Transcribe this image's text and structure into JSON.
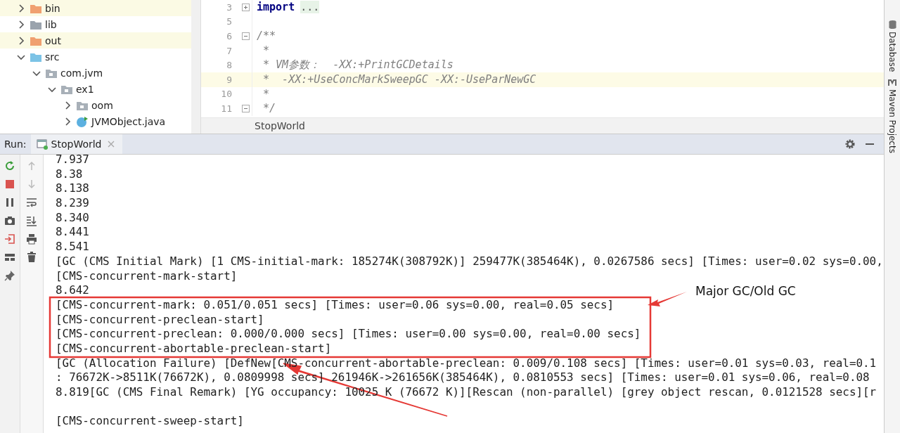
{
  "project_tree": [
    {
      "label": "bin",
      "kind": "excluded",
      "expanded": false
    },
    {
      "label": "lib",
      "kind": "folder",
      "expanded": false
    },
    {
      "label": "out",
      "kind": "excluded",
      "expanded": false
    },
    {
      "label": "src",
      "kind": "source",
      "expanded": true,
      "children": [
        {
          "label": "com.jvm",
          "kind": "package",
          "expanded": true,
          "children": [
            {
              "label": "ex1",
              "kind": "package",
              "expanded": true,
              "children": [
                {
                  "label": "oom",
                  "kind": "package",
                  "expanded": false
                },
                {
                  "label": "JVMObject.java",
                  "kind": "class",
                  "expanded": false
                }
              ]
            }
          ]
        }
      ]
    }
  ],
  "editor": {
    "lines": [
      {
        "number": "3",
        "kind": "import",
        "keyword": "import",
        "folded_text": "...",
        "foldable": true,
        "collapsed": true,
        "current": false
      },
      {
        "number": "5",
        "kind": "comment",
        "current": false
      },
      {
        "number": "6",
        "kind": "comment",
        "text": "/**",
        "foldable": true,
        "collapsed": false,
        "current": false
      },
      {
        "number": "7",
        "kind": "comment",
        "text": " *",
        "current": false
      },
      {
        "number": "8",
        "kind": "comment",
        "text": " * VM参数：  -XX:+PrintGCDetails",
        "current": false
      },
      {
        "number": "9",
        "kind": "comment",
        "text": " *  -XX:+UseConcMarkSweepGC -XX:-UseParNewGC",
        "current": true
      },
      {
        "number": "10",
        "kind": "comment",
        "text": " *",
        "current": false
      },
      {
        "number": "11",
        "kind": "comment",
        "text": " */",
        "foldable": true,
        "collapsed": false,
        "current": false
      }
    ],
    "breadcrumb": "StopWorld"
  },
  "side_tabs": [
    {
      "label": "Database",
      "kind": "database"
    },
    {
      "label": "Maven Projects",
      "kind": "maven"
    }
  ],
  "run_panel": {
    "label": "Run:",
    "tabs": [
      {
        "label": "StopWorld",
        "selected": true
      }
    ],
    "toolbar": [
      {
        "kind": "rerun"
      },
      {
        "kind": "stop"
      },
      {
        "kind": "pause"
      },
      {
        "kind": "camera"
      },
      {
        "kind": "exit"
      },
      {
        "kind": "layout"
      },
      {
        "kind": "pin"
      }
    ],
    "toolbar_2": [
      {
        "kind": "up",
        "disabled": true
      },
      {
        "kind": "down",
        "disabled": true
      },
      {
        "kind": "wrap"
      },
      {
        "kind": "scroll-end"
      },
      {
        "kind": "print"
      },
      {
        "kind": "trash"
      }
    ],
    "output": [
      {
        "text": "7.937"
      },
      {
        "text": "8.38"
      },
      {
        "text": "8.138"
      },
      {
        "text": "8.239"
      },
      {
        "text": "8.340"
      },
      {
        "text": "8.441"
      },
      {
        "text": "8.541"
      },
      {
        "text": "[GC (CMS Initial Mark) [1 CMS-initial-mark: 185274K(308792K)] 259477K(385464K), 0.0267586 secs] [Times: user=0.02 sys=0.00,"
      },
      {
        "text": "[CMS-concurrent-mark-start]"
      },
      {
        "text": "8.642"
      },
      {
        "text": "[CMS-concurrent-mark: 0.051/0.051 secs] [Times: user=0.06 sys=0.00, real=0.05 secs]"
      },
      {
        "text": "[CMS-concurrent-preclean-start]"
      },
      {
        "text": "[CMS-concurrent-preclean: 0.000/0.000 secs] [Times: user=0.00 sys=0.00, real=0.00 secs]"
      },
      {
        "text": "[CMS-concurrent-abortable-preclean-start]"
      },
      {
        "text": "[GC (Allocation Failure) [DefNew[CMS-concurrent-abortable-preclean: 0.009/0.108 secs] [Times: user=0.01 sys=0.03, real=0.1"
      },
      {
        "text": ": 76672K->8511K(76672K), 0.0809998 secs] 261946K->261656K(385464K), 0.0810553 secs] [Times: user=0.01 sys=0.06, real=0.08"
      },
      {
        "text": "8.819[GC (CMS Final Remark) [YG occupancy: 10025 K (76672 K)][Rescan (non-parallel) [grey object rescan, 0.0121528 secs][r"
      },
      {
        "text": "[CMS-concurrent-sweep-start]",
        "blank_line_before": true
      }
    ]
  },
  "annotation": {
    "label": "Major GC/Old GC"
  }
}
